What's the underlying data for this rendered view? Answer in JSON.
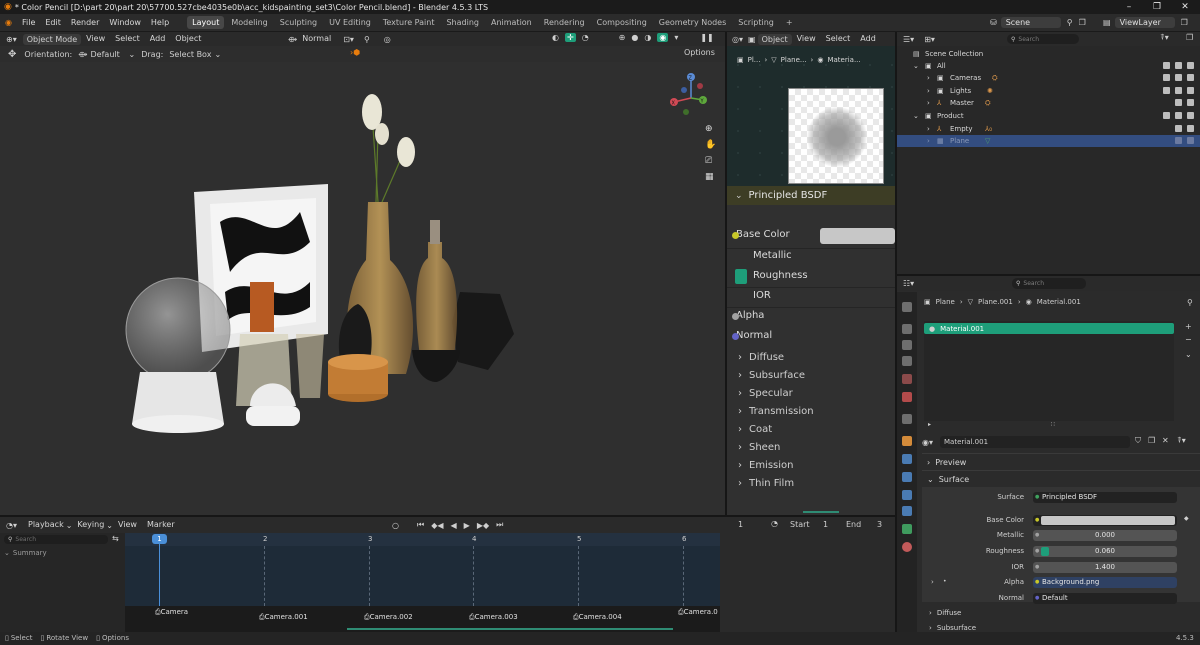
{
  "window": {
    "title": "* Color Pencil [D:\\part 20\\part 20\\57700.527cbe4035e0b\\acc_kidspainting_set3\\Color Pencil.blend] - Blender 4.5.3 LTS",
    "minimize": "–",
    "maximize": "❐",
    "close": "✕"
  },
  "menu": [
    "File",
    "Edit",
    "Render",
    "Window",
    "Help"
  ],
  "workspaces": [
    "Layout",
    "Modeling",
    "Sculpting",
    "UV Editing",
    "Texture Paint",
    "Shading",
    "Animation",
    "Rendering",
    "Compositing",
    "Geometry Nodes",
    "Scripting"
  ],
  "active_workspace": "Layout",
  "add_workspace": "+",
  "scene": "Scene",
  "view_layer": "ViewLayer",
  "viewport": {
    "mode": "Object Mode",
    "menus": [
      "View",
      "Select",
      "Add",
      "Object"
    ],
    "transform": "Normal",
    "orientation_label": "Orientation:",
    "orientation_value": "Default",
    "drag_label": "Drag:",
    "drag_value": "Select Box",
    "options": "Options",
    "axes": {
      "x": "X",
      "y": "Y",
      "z": "Z"
    }
  },
  "node_editor": {
    "mode": "Object",
    "menus": [
      "View",
      "Select",
      "Add"
    ],
    "breadcrumb": [
      "Pl...",
      "Plane...",
      "Materia..."
    ],
    "node_title": "Principled BSDF",
    "sockets": [
      "Base Color",
      "Metallic",
      "Roughness",
      "IOR",
      "Alpha",
      "Normal"
    ],
    "panels": [
      "Diffuse",
      "Subsurface",
      "Specular",
      "Transmission",
      "Coat",
      "Sheen",
      "Emission",
      "Thin Film"
    ]
  },
  "outliner": {
    "search_placeholder": "Search",
    "rows": [
      {
        "label": "Scene Collection"
      },
      {
        "label": "All"
      },
      {
        "label": "Cameras"
      },
      {
        "label": "Lights"
      },
      {
        "label": "Master"
      },
      {
        "label": "Product"
      },
      {
        "label": "Empty"
      },
      {
        "label": "Plane"
      }
    ]
  },
  "properties": {
    "search_placeholder": "Search",
    "breadcrumb": [
      "Plane",
      "Plane.001",
      "Material.001"
    ],
    "slot": "Material.001",
    "material_name": "Material.001",
    "sections": {
      "preview": "Preview",
      "surface": "Surface",
      "diffuse": "Diffuse",
      "subsurface": "Subsurface"
    },
    "fields": [
      {
        "label": "Surface",
        "value": "Principled BSDF"
      },
      {
        "label": "Base Color",
        "value": ""
      },
      {
        "label": "Metallic",
        "value": "0.000"
      },
      {
        "label": "Roughness",
        "value": "0.060"
      },
      {
        "label": "IOR",
        "value": "1.400"
      },
      {
        "label": "Alpha",
        "value": "Background.png"
      },
      {
        "label": "Normal",
        "value": "Default"
      }
    ],
    "roughness_fill": 0.06
  },
  "timeline": {
    "menus": [
      "Playback",
      "Keying",
      "View",
      "Marker"
    ],
    "current_frame": "1",
    "start_label": "Start",
    "start": "1",
    "end_label": "End",
    "end": "3",
    "search_placeholder": "Search",
    "summary": "Summary",
    "frames": [
      "1",
      "2",
      "3",
      "4",
      "5",
      "6"
    ],
    "cameras": [
      "Camera",
      "Camera.001",
      "Camera.002",
      "Camera.003",
      "Camera.004",
      "Camera.0"
    ]
  },
  "status": {
    "select": "Select",
    "rotate": "Rotate View",
    "options": "Options",
    "version": "4.5.3"
  },
  "colors": {
    "accent_green": "#1e9e7a",
    "selection_blue": "#334d80",
    "node_header": "#3d3d25"
  }
}
